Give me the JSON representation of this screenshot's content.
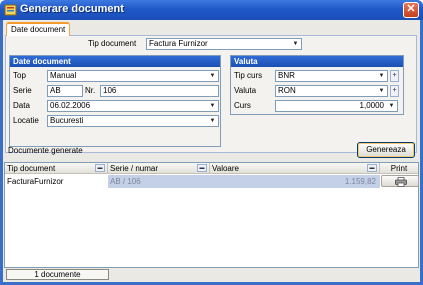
{
  "window": {
    "title": "Generare document"
  },
  "tab": {
    "label": "Date document"
  },
  "tip_document": {
    "label": "Tip document",
    "value": "Factura Furnizor"
  },
  "date_document": {
    "header": "Date document",
    "top": {
      "label": "Top",
      "value": "Manual"
    },
    "serie": {
      "label": "Serie",
      "value": "AB"
    },
    "nr": {
      "label": "Nr.",
      "value": "106"
    },
    "data": {
      "label": "Data",
      "value": "06.02.2006"
    },
    "locatie": {
      "label": "Locatie",
      "value": "Bucuresti"
    }
  },
  "valuta": {
    "header": "Valuta",
    "tip_curs": {
      "label": "Tip curs",
      "value": "BNR"
    },
    "valuta": {
      "label": "Valuta",
      "value": "RON"
    },
    "curs": {
      "label": "Curs",
      "value": "1,0000"
    }
  },
  "generated": {
    "label": "Documente generate",
    "button": "Genereaza"
  },
  "grid": {
    "columns": [
      "Tip document",
      "Serie / numar",
      "Valoare",
      "Print"
    ],
    "rows": [
      {
        "tip": "FacturaFurnizor",
        "serie": "AB / 106",
        "valoare": "1.159,82"
      }
    ]
  },
  "status": {
    "count": "1 documente"
  },
  "colors": {
    "titlebar": "#2158c8",
    "accent": "#f59a2e",
    "group_header": "#2f6cd6",
    "selection": "#c4d0e8"
  },
  "icons": [
    "app-icon",
    "close-icon",
    "chevron-down-icon",
    "plus-icon",
    "printer-icon"
  ]
}
